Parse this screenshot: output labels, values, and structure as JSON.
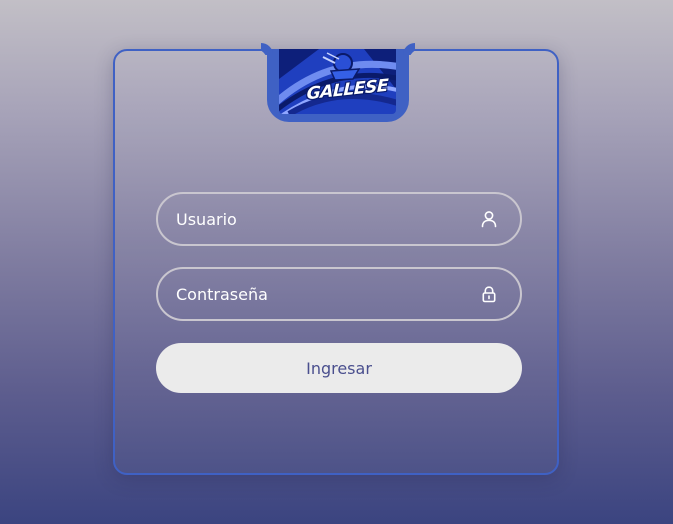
{
  "logo": {
    "text": "GALLESE"
  },
  "form": {
    "username": {
      "placeholder": "Usuario",
      "value": ""
    },
    "password": {
      "placeholder": "Contraseña",
      "value": ""
    },
    "submit_label": "Ingresar"
  },
  "icons": {
    "username": "user-icon",
    "password": "lock-icon"
  },
  "colors": {
    "accent": "#3f61c4",
    "button_bg": "#ebebeb",
    "button_text": "#4a4f8e",
    "field_border": "#c9c6cf"
  }
}
